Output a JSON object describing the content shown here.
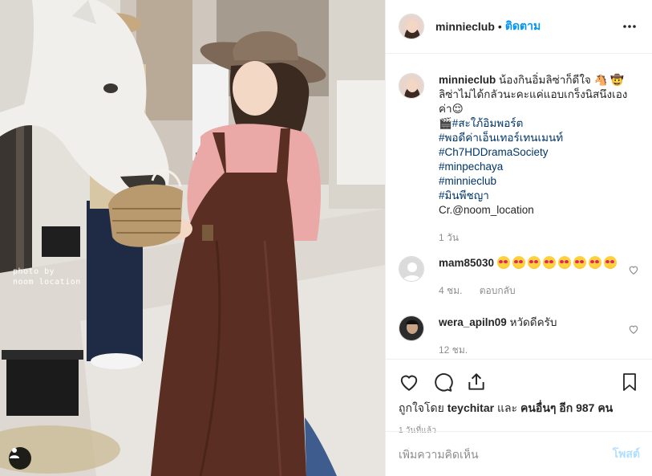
{
  "photo": {
    "watermark": "photo by\nnoom location",
    "user_tag_icon": "person-icon"
  },
  "header": {
    "username": "minnieclub",
    "separator": "•",
    "follow_label": "ติดตาม",
    "more_icon": "more-horizontal-icon"
  },
  "caption": {
    "username": "minnieclub",
    "text_line1": "น้องกินอิ่มลิซ่าก็ดีใจ",
    "text_line2": "ลิซ่าไม่ได้กลัวนะคะแค่แอบเกร็งนิสนึงเองค่า",
    "hashtags": [
      "🎬#สะใภ้อิมพอร์ต",
      "#พอดีค่าเอ็นเทอร์เทนเมนท์",
      "#Ch7HDDramaSociety",
      "#minpechaya",
      "#minnieclub",
      "#มินพีชญา"
    ],
    "credit": "Cr.@noom_location",
    "age": "1 วัน"
  },
  "comments": [
    {
      "username": "mam85030",
      "emoji_count": 8,
      "age": "4 ชม.",
      "reply_label": "ตอบกลับ"
    },
    {
      "username": "wera_apiln09",
      "text": "หวัดดีครับ",
      "age": "12 ชม."
    }
  ],
  "actions": {
    "likes_prefix": "ถูกใจโดย",
    "liker": "teychitar",
    "likes_middle": "และ",
    "likes_others": "คนอื่นๆ อีก 987 คน",
    "time": "1 วันที่แล้ว"
  },
  "add_comment": {
    "placeholder": "เพิ่มความคิดเห็น",
    "post_label": "โพสต์"
  },
  "colors": {
    "link": "#003569",
    "follow": "#0095f6",
    "muted": "#8e8e8e",
    "post_disabled": "#b2dffc"
  }
}
